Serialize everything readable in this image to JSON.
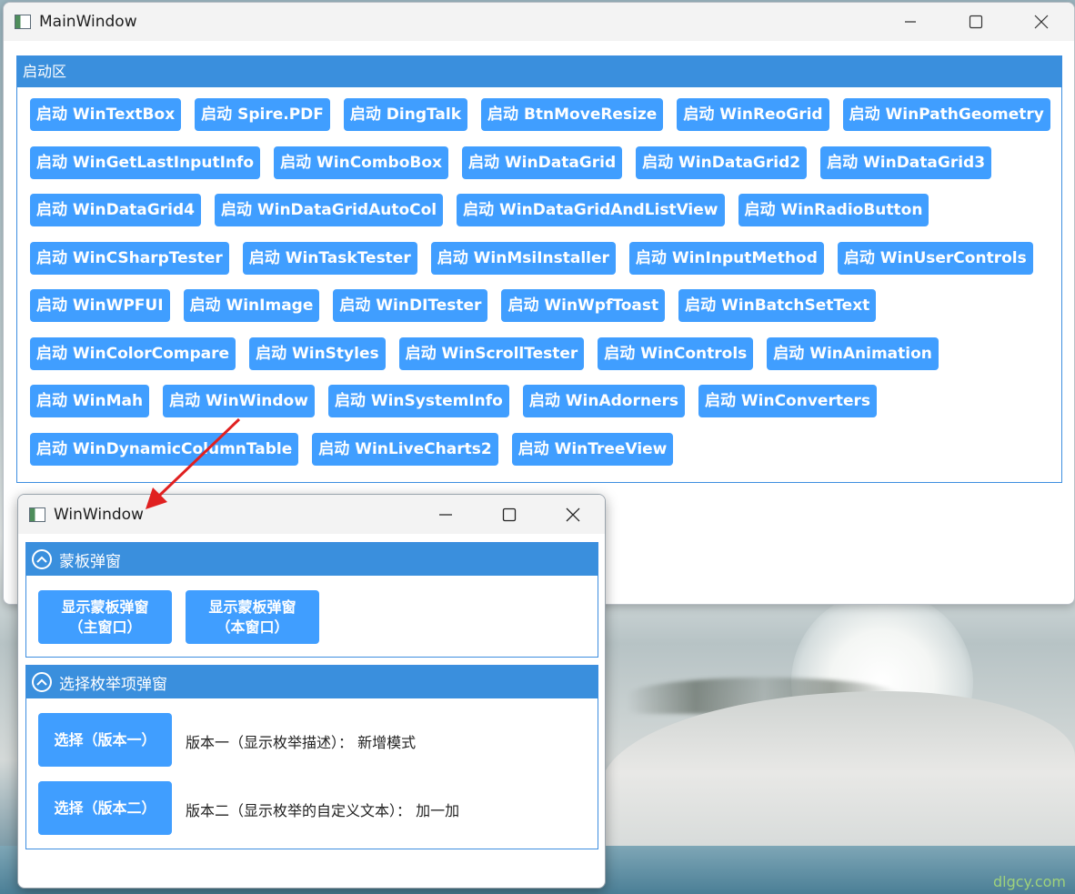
{
  "main_window": {
    "title": "MainWindow",
    "group_title": "启动区",
    "rows": [
      [
        "启动 WinTextBox",
        "启动 Spire.PDF",
        "启动 DingTalk",
        "启动 BtnMoveResize",
        "启动 WinReoGrid",
        "启动 WinPathGeometry"
      ],
      [
        "启动 WinGetLastInputInfo",
        "启动 WinComboBox",
        "启动 WinDataGrid",
        "启动 WinDataGrid2",
        "启动 WinDataGrid3"
      ],
      [
        "启动 WinDataGrid4",
        "启动 WinDataGridAutoCol",
        "启动 WinDataGridAndListView",
        "启动 WinRadioButton"
      ],
      [
        "启动 WinCSharpTester",
        "启动 WinTaskTester",
        "启动 WinMsiInstaller",
        "启动 WinInputMethod",
        "启动 WinUserControls"
      ],
      [
        "启动 WinWPFUI",
        "启动 WinImage",
        "启动 WinDITester",
        "启动 WinWpfToast",
        "启动 WinBatchSetText"
      ],
      [
        "启动 WinColorCompare",
        "启动 WinStyles",
        "启动 WinScrollTester",
        "启动 WinControls",
        "启动 WinAnimation"
      ],
      [
        "启动 WinMah",
        "启动 WinWindow",
        "启动 WinSystemInfo",
        "启动 WinAdorners",
        "启动 WinConverters"
      ],
      [
        "启动 WinDynamicColumnTable",
        "启动 WinLiveCharts2",
        "启动 WinTreeView"
      ]
    ]
  },
  "child_window": {
    "title": "WinWindow",
    "mask_group": {
      "title": "蒙板弹窗",
      "btn_main_line1": "显示蒙板弹窗",
      "btn_main_line2": "（主窗口）",
      "btn_self_line1": "显示蒙板弹窗",
      "btn_self_line2": "（本窗口）"
    },
    "enum_group": {
      "title": "选择枚举项弹窗",
      "btn_v1": "选择（版本一）",
      "desc_v1": "版本一（显示枚举描述）： 新增模式",
      "btn_v2": "选择（版本二）",
      "desc_v2": "版本二（显示枚举的自定义文本）： 加一加"
    }
  },
  "watermark": "dlgcy.com",
  "colors": {
    "accent": "#409eff",
    "header_blue": "#3a8fdd",
    "arrow_red": "#e02020"
  },
  "icons": [
    "app-icon",
    "minimize-icon",
    "maximize-icon",
    "close-icon",
    "chevron-up-icon"
  ]
}
